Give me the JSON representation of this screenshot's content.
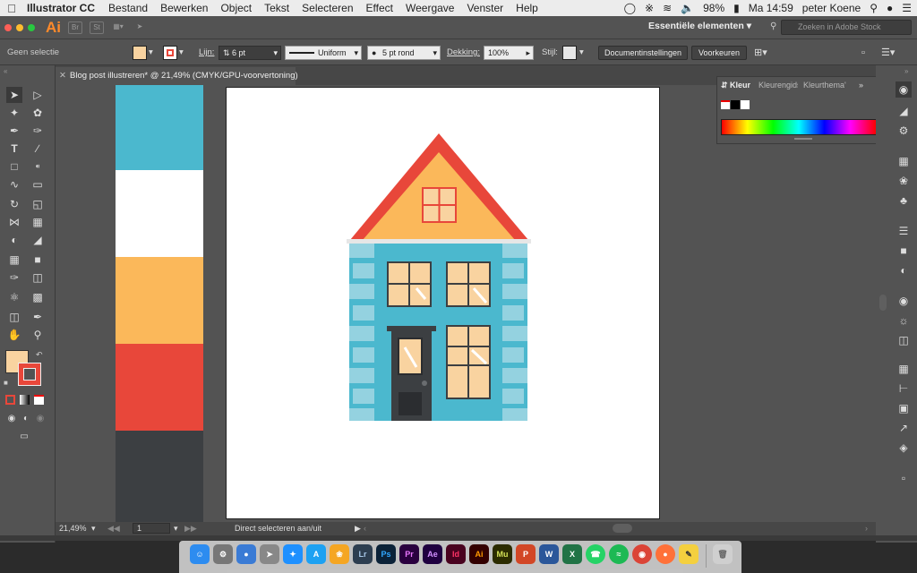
{
  "menubar": {
    "app_name": "Illustrator CC",
    "items": [
      "Bestand",
      "Bewerken",
      "Object",
      "Tekst",
      "Selecteren",
      "Effect",
      "Weergave",
      "Venster",
      "Help"
    ],
    "battery": "98%",
    "clock": "Ma 14:59",
    "user": "peter Koene"
  },
  "appbar": {
    "logo": "Ai",
    "workspace": "Essentiële elementen",
    "stock_placeholder": "Zoeken in Adobe Stock"
  },
  "control": {
    "selection": "Geen selectie",
    "stroke_label": "Lijn:",
    "stroke_value": "6 pt",
    "profile": "Uniform",
    "brush": "5 pt rond",
    "opacity_label": "Dekking:",
    "opacity_value": "100%",
    "style_label": "Stijl:",
    "doc_settings": "Documentinstellingen",
    "preferences": "Voorkeuren"
  },
  "document": {
    "tab_title": "Blog post illustreren* @ 21,49% (CMYK/GPU-voorvertoning)"
  },
  "colors": {
    "fill": "#f9d3a0",
    "stroke": "#e8473a",
    "swatches": [
      "#4bb8ce",
      "#ffffff",
      "#fbb85a",
      "#e8473a",
      "#3c3f42"
    ]
  },
  "status": {
    "zoom": "21,49%",
    "page": "1",
    "message": "Direct selecteren aan/uit"
  },
  "color_panel": {
    "tabs": [
      "Kleur",
      "Kleurengids",
      "Kleurthema's"
    ]
  },
  "dock_apps": [
    "Lr",
    "Ps",
    "Pr",
    "Ae",
    "Id",
    "Ai",
    "Mu",
    "W",
    "X"
  ]
}
